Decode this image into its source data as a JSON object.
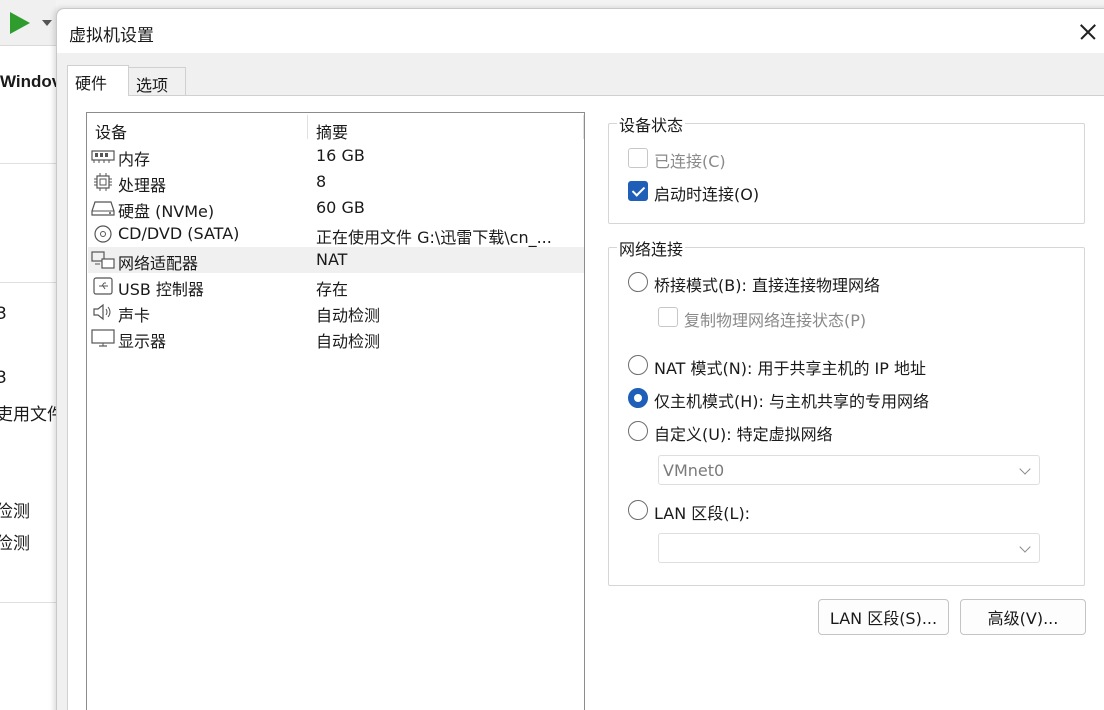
{
  "background_app": {
    "text_windows": "Windov",
    "text_3a": "3",
    "text_3b": "3",
    "text_using": "吏用文件",
    "text_detect1": "俭测",
    "text_detect2": "俭测"
  },
  "dialog": {
    "title": "虚拟机设置",
    "tabs": [
      {
        "label": "硬件",
        "active": true
      },
      {
        "label": "选项",
        "active": false
      }
    ]
  },
  "device_list": {
    "header_device": "设备",
    "header_summary": "摘要",
    "rows": [
      {
        "icon": "memory-icon",
        "name": "内存",
        "summary": "16 GB"
      },
      {
        "icon": "processor-icon",
        "name": "处理器",
        "summary": "8"
      },
      {
        "icon": "hard-disk-icon",
        "name": "硬盘 (NVMe)",
        "summary": "60 GB"
      },
      {
        "icon": "cd-dvd-icon",
        "name": "CD/DVD (SATA)",
        "summary": "正在使用文件 G:\\迅雷下载\\cn_..."
      },
      {
        "icon": "network-adapter-icon",
        "name": "网络适配器",
        "summary": "NAT"
      },
      {
        "icon": "usb-icon",
        "name": "USB 控制器",
        "summary": "存在"
      },
      {
        "icon": "sound-icon",
        "name": "声卡",
        "summary": "自动检测"
      },
      {
        "icon": "display-icon",
        "name": "显示器",
        "summary": "自动检测"
      }
    ],
    "selected_index": 4
  },
  "device_status": {
    "title": "设备状态",
    "connected": {
      "label": "已连接(C)",
      "checked": false,
      "enabled": false
    },
    "connect_at_power_on": {
      "label": "启动时连接(O)",
      "checked": true,
      "enabled": true
    }
  },
  "network_connection": {
    "title": "网络连接",
    "bridged": {
      "label": "桥接模式(B): 直接连接物理网络",
      "checked": false
    },
    "replicate": {
      "label": "复制物理网络连接状态(P)",
      "checked": false,
      "enabled": false
    },
    "nat": {
      "label": "NAT 模式(N): 用于共享主机的 IP 地址",
      "checked": false
    },
    "host_only": {
      "label": "仅主机模式(H): 与主机共享的专用网络",
      "checked": true
    },
    "custom": {
      "label": "自定义(U): 特定虚拟网络",
      "checked": false
    },
    "custom_select_value": "VMnet0",
    "lan_segment": {
      "label": "LAN 区段(L):",
      "checked": false
    },
    "lan_select_value": ""
  },
  "buttons": {
    "lan_segments": "LAN 区段(S)...",
    "advanced": "高级(V)..."
  },
  "colors": {
    "accent": "#1f5fb8",
    "play": "#2e9d2e"
  }
}
